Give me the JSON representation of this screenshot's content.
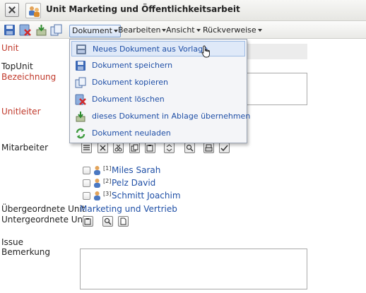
{
  "window": {
    "title": "Unit Marketing und Öffentlichkeitsarbeit"
  },
  "toolbar": {
    "menus": [
      {
        "label": "Dokument"
      },
      {
        "label": "Bearbeiten"
      },
      {
        "label": "Ansicht"
      },
      {
        "label": "Rückverweise"
      }
    ]
  },
  "dropdown": {
    "items": [
      {
        "label": "Neues Dokument aus Vorlage",
        "icon": "new-from-template-icon",
        "highlighted": true
      },
      {
        "label": "Dokument speichern",
        "icon": "save-icon"
      },
      {
        "label": "Dokument kopieren",
        "icon": "copy-icon"
      },
      {
        "label": "Dokument löschen",
        "icon": "delete-icon"
      },
      {
        "label": "dieses Dokument in Ablage übernehmen",
        "icon": "archive-icon"
      },
      {
        "label": "Dokument neuladen",
        "icon": "reload-icon"
      }
    ]
  },
  "form": {
    "unit_label": "Unit",
    "topunit_label": "TopUnit",
    "bezeichnung_label": "Bezeichnung",
    "unitleiter_label": "Unitleiter",
    "mitarbeiter_label": "Mitarbeiter",
    "mitarbeiter": [
      {
        "index": "[1]",
        "name": "Miles Sarah"
      },
      {
        "index": "[2]",
        "name": "Pelz David"
      },
      {
        "index": "[3]",
        "name": "Schmitt Joachim"
      }
    ],
    "uebergeordnete_unit_label": "Übergeordnete Unit",
    "uebergeordnete_unit_value": "Marketing und Vertrieb",
    "untergeordnete_units_label": "Untergeordnete Units",
    "issue_label": "Issue",
    "bemerkung_label": "Bemerkung"
  },
  "colors": {
    "required_label": "#c0392b",
    "link": "#1f4fa6",
    "menu_highlight": "#dfe9f8"
  }
}
